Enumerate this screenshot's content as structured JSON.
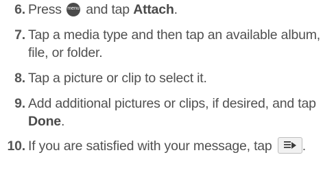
{
  "steps": [
    {
      "number": "6.",
      "pre": "Press",
      "icon_label": "menu",
      "mid": "and tap",
      "bold": "Attach",
      "post": "."
    },
    {
      "number": "7.",
      "text": "Tap a media type and then tap an available album, file, or folder."
    },
    {
      "number": "8.",
      "text": "Tap a picture or clip to select it."
    },
    {
      "number": "9.",
      "pre": "Add additional pictures or clips, if desired, and tap",
      "bold": "Done",
      "post": "."
    },
    {
      "number": "10.",
      "pre": "If you are satisfied with your message, tap",
      "post": "."
    }
  ],
  "icons": {
    "menu": "menu-key-icon",
    "send": "send-message-icon"
  }
}
